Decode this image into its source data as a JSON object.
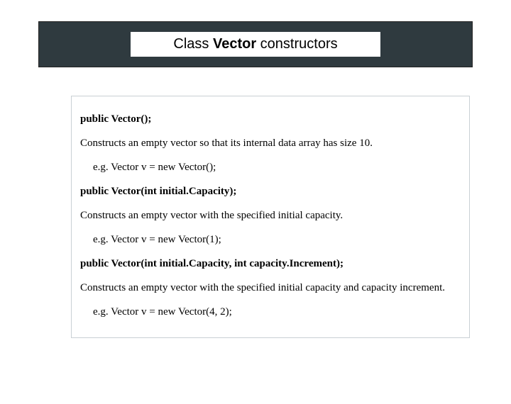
{
  "title": {
    "prefix": "Class ",
    "bold": "Vector",
    "suffix": " constructors"
  },
  "sections": [
    {
      "signature": "public Vector();",
      "description": "Constructs an empty vector so that its internal data array has size 10.",
      "example": "e.g.  Vector v = new Vector();"
    },
    {
      "signature": "public Vector(int initial.Capacity);",
      "description": "Constructs an empty vector with the specified initial capacity.",
      "example": "e.g.  Vector v = new Vector(1);"
    },
    {
      "signature": "public Vector(int initial.Capacity, int capacity.Increment);",
      "description": "Constructs an empty vector with the specified initial capacity and capacity increment.",
      "example": "e.g.  Vector v = new Vector(4, 2);"
    }
  ]
}
